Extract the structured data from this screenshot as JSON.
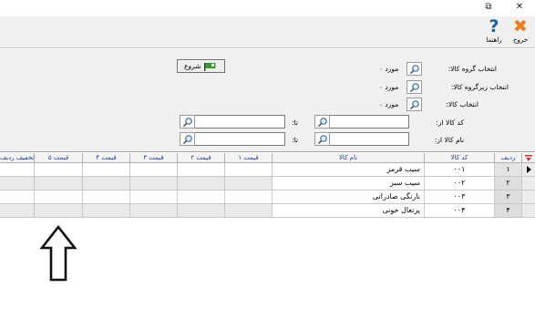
{
  "window": {
    "restore_symbol": "⧉",
    "close_symbol": "✕"
  },
  "toolbar": {
    "exit_label": "خروج",
    "help_label": "راهنما"
  },
  "filters": {
    "group_label": "انتخاب گروه کالا:",
    "group_value": "۰ مورد",
    "subgroup_label": "انتخاب زیرگروه کالا:",
    "subgroup_value": "۰ مورد",
    "item_label": "انتخاب کالا:",
    "item_value": "۰ مورد",
    "code_from_label": "کد کالا از:",
    "code_to_label": "تا:",
    "name_from_label": "نام کالا از:",
    "name_to_label": "تا:",
    "code_from_value": "",
    "code_to_value": "",
    "name_from_value": "",
    "name_to_value": "",
    "start_button": "شروع"
  },
  "grid": {
    "columns": {
      "row": "ردیف",
      "code": "کد کالا",
      "name": "نام کالا",
      "price1": "قیمت ۱",
      "price2": "قیمت ۲",
      "price3": "قیمت ۳",
      "price4": "قیمت ۴",
      "price5": "قیمت ۵",
      "discount": "تخفیف ردیف%"
    },
    "rows": [
      {
        "num": "۱",
        "code": "۰۰۱",
        "name": "سیب قرمز"
      },
      {
        "num": "۲",
        "code": "۰۰۲",
        "name": "سیب سبز"
      },
      {
        "num": "۳",
        "code": "۰۰۳",
        "name": "نارنگی صادراتی"
      },
      {
        "num": "۴",
        "code": "۰۰۴",
        "name": "پرتغال خونی"
      }
    ]
  },
  "colors": {
    "header_text": "#1f3ea3",
    "exit_icon": "#f07a1a",
    "help_icon": "#1f5fa8",
    "flag": "#2f9a2f"
  }
}
